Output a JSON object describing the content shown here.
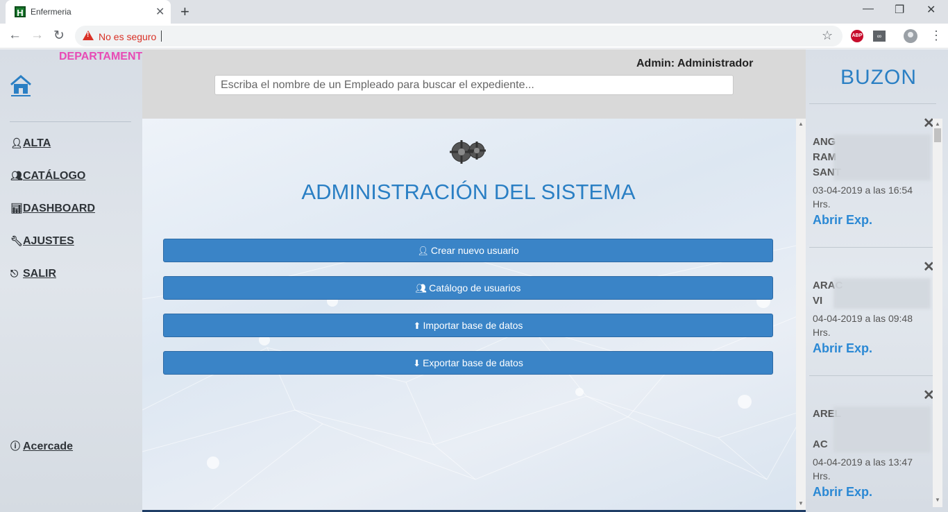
{
  "browser": {
    "tab_title": "Enfermeria",
    "tab_close": "✕",
    "new_tab": "+",
    "security_text": "No es seguro",
    "window_minimize": "—",
    "window_restore": "❐",
    "window_close": "✕",
    "extension_abp": "ABP"
  },
  "sidebar": {
    "department": "DEPARTAMENTO DE ENFERMERIA",
    "items": [
      {
        "label": "ALTA",
        "icon": "user-icon"
      },
      {
        "label": "CATÁLOGO",
        "icon": "users-icon"
      },
      {
        "label": "DASHBOARD",
        "icon": "stats-icon"
      },
      {
        "label": "AJUSTES",
        "icon": "wrench-icon"
      },
      {
        "label": "SALIR",
        "icon": "logout-icon"
      }
    ],
    "about": "Acercade"
  },
  "header": {
    "admin": "Admin: Administrador",
    "search_placeholder": "Escriba el nombre de un Empleado para buscar el expediente..."
  },
  "main": {
    "title": "ADMINISTRACIÓN DEL SISTEMA",
    "buttons": [
      {
        "label": "Crear nuevo usuario",
        "icon": "user-add-icon"
      },
      {
        "label": "Catálogo de usuarios",
        "icon": "users-icon"
      },
      {
        "label": "Importar base de datos",
        "icon": "upload-icon"
      },
      {
        "label": "Exportar base de datos",
        "icon": "download-icon"
      }
    ]
  },
  "inbox": {
    "title": "BUZON",
    "messages": [
      {
        "name_lines": [
          "ANG",
          "RAM",
          "SANT"
        ],
        "date": "03-04-2019 a las 16:54 Hrs.",
        "link": "Abrir Exp."
      },
      {
        "name_lines": [
          "ARAC",
          "VI"
        ],
        "date": "04-04-2019 a las 09:48 Hrs.",
        "link": "Abrir Exp."
      },
      {
        "name_lines": [
          "AREL",
          "",
          "AC"
        ],
        "date": "04-04-2019 a las 13:47 Hrs.",
        "link": "Abrir Exp."
      }
    ]
  }
}
